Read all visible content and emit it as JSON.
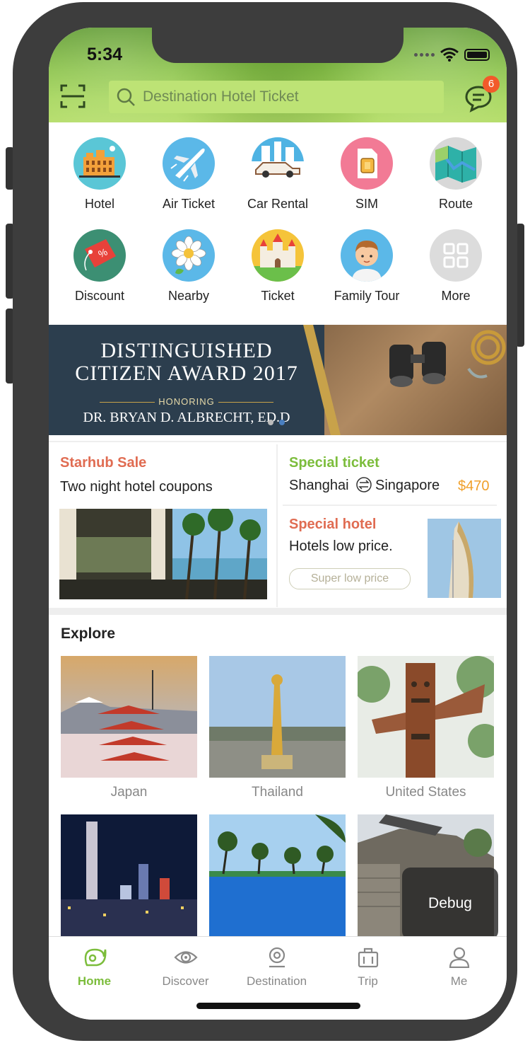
{
  "status_bar": {
    "time": "5:34"
  },
  "header": {
    "search_placeholder": "Destination Hotel Ticket",
    "message_count": "6"
  },
  "categories": [
    {
      "label": "Hotel",
      "icon": "hotel-icon"
    },
    {
      "label": "Air Ticket",
      "icon": "airplane-icon"
    },
    {
      "label": "Car Rental",
      "icon": "car-icon"
    },
    {
      "label": "SIM",
      "icon": "sim-card-icon"
    },
    {
      "label": "Route",
      "icon": "map-icon"
    },
    {
      "label": "Discount",
      "icon": "discount-tag-icon"
    },
    {
      "label": "Nearby",
      "icon": "flower-icon"
    },
    {
      "label": "Ticket",
      "icon": "castle-icon"
    },
    {
      "label": "Family Tour",
      "icon": "boy-avatar-icon"
    },
    {
      "label": "More",
      "icon": "grid-icon"
    }
  ],
  "banner": {
    "line1": "DISTINGUISHED",
    "line2": "CITIZEN AWARD 2017",
    "honoring": "HONORING",
    "name": "DR. BRYAN D. ALBRECHT, ED.D"
  },
  "deals": {
    "starhub": {
      "title": "Starhub Sale",
      "subtitle": "Two night hotel coupons"
    },
    "special_ticket": {
      "title": "Special ticket",
      "from": "Shanghai",
      "to": "Singapore",
      "price": "$470"
    },
    "special_hotel": {
      "title": "Special hotel",
      "subtitle": "Hotels low price.",
      "tag": "Super low price"
    }
  },
  "explore": {
    "title": "Explore",
    "places": [
      {
        "name": "Japan"
      },
      {
        "name": "Thailand"
      },
      {
        "name": "United States"
      },
      {
        "name": ""
      },
      {
        "name": ""
      },
      {
        "name": ""
      }
    ]
  },
  "debug_label": "Debug",
  "tabs": [
    {
      "label": "Home",
      "icon": "home-icon",
      "active": true
    },
    {
      "label": "Discover",
      "icon": "eye-icon",
      "active": false
    },
    {
      "label": "Destination",
      "icon": "location-pin-icon",
      "active": false
    },
    {
      "label": "Trip",
      "icon": "suitcase-icon",
      "active": false
    },
    {
      "label": "Me",
      "icon": "person-icon",
      "active": false
    }
  ],
  "colors": {
    "accent": "#7cbd3c",
    "sale_red": "#e06c52",
    "special_green": "#7cbd3c",
    "price_orange": "#f0a02a"
  }
}
